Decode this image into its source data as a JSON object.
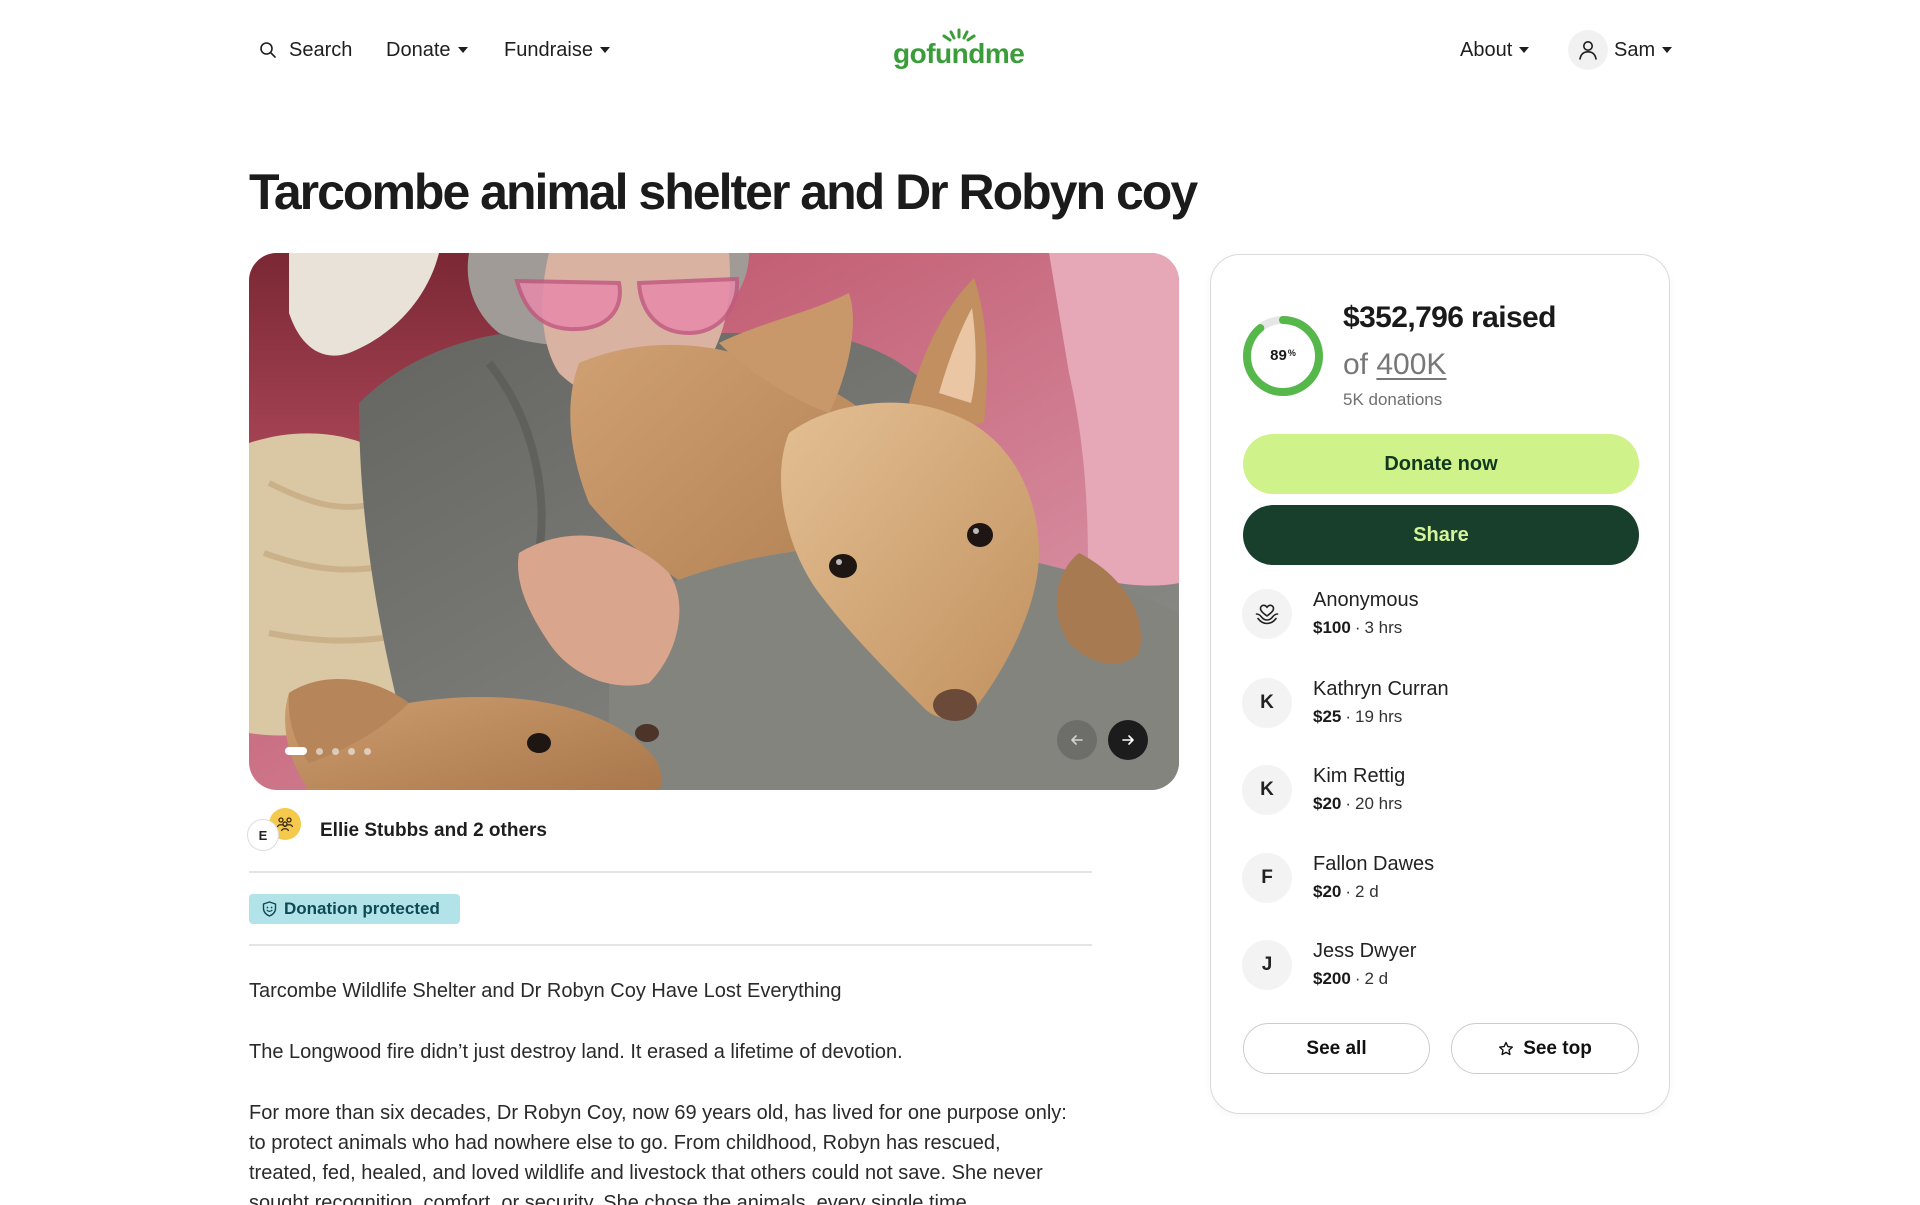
{
  "header": {
    "search_label": "Search",
    "search_icon": "search-icon",
    "donate_label": "Donate",
    "fundraise_label": "Fundraise",
    "logo_text": "gofundme",
    "about_label": "About",
    "user_name": "Sam",
    "user_icon": "user-icon"
  },
  "campaign": {
    "title": "Tarcombe animal shelter and Dr Robyn coy",
    "carousel": {
      "slide_count": 5,
      "active_slide": 1,
      "prev_icon": "arrow-left-icon",
      "next_icon": "arrow-right-icon"
    },
    "organizers": {
      "avatar_initial": "E",
      "group_icon": "group-icon",
      "label": "Ellie Stubbs and 2 others"
    },
    "protection_badge": {
      "icon": "shield-icon",
      "label": "Donation protected"
    },
    "story": [
      [
        "Tarcombe Wildlife Shelter and Dr Robyn Coy Have Lost Everything"
      ],
      [
        "The Longwood fire didn’t just destroy land. It erased a lifetime of devotion."
      ],
      [
        "For more than six decades, Dr Robyn Coy, now 69 years old, has lived for one purpose only:",
        "to protect animals who had nowhere else to go. From childhood, Robyn has rescued,",
        "treated, fed, healed, and loved wildlife and livestock that others could not save. She never",
        "sought recognition, comfort, or security. She chose the animals, every single time."
      ]
    ]
  },
  "progress": {
    "percent": 89,
    "percent_label": "89",
    "percent_sign": "%",
    "raised": "$352,796 raised",
    "goal_prefix": "of",
    "goal": "400K",
    "donations": "5K donations"
  },
  "actions": {
    "donate_label": "Donate now",
    "share_label": "Share",
    "see_all_label": "See all",
    "see_top_label": "See top",
    "see_top_icon": "star-icon"
  },
  "donations": {
    "separator": "·",
    "items": [
      {
        "initial": "",
        "icon": "hands-heart-icon",
        "name": "Anonymous",
        "amount": "$100",
        "time": "3 hrs"
      },
      {
        "initial": "K",
        "name": "Kathryn Curran",
        "amount": "$25",
        "time": "19 hrs"
      },
      {
        "initial": "K",
        "name": "Kim Rettig",
        "amount": "$20",
        "time": "20 hrs"
      },
      {
        "initial": "F",
        "name": "Fallon Dawes",
        "amount": "$20",
        "time": "2 d"
      },
      {
        "initial": "J",
        "name": "Jess Dwyer",
        "amount": "$200",
        "time": "2 d"
      }
    ]
  },
  "colors": {
    "brand_green": "#3a9d3a",
    "donate_bg": "#cff28a",
    "donate_text": "#10391f",
    "share_bg": "#183f2c",
    "share_text": "#d4f59a",
    "ring": "#56b84a",
    "ring_track": "#e6e6e6",
    "badge_bg": "#b2e3e9",
    "badge_text": "#0d4a54",
    "organizer_avatar": "#f5c94c"
  }
}
